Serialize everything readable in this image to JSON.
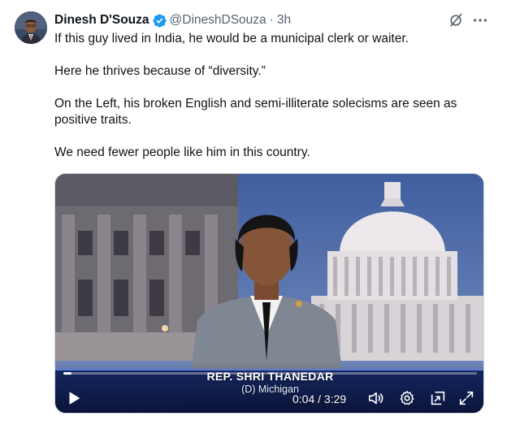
{
  "tweet": {
    "author": {
      "display_name": "Dinesh D'Souza",
      "handle": "@DineshDSouza",
      "verified": true
    },
    "separator": "·",
    "time": "3h",
    "paragraphs": [
      "If this guy lived in India, he would be a municipal clerk or waiter.",
      "Here he thrives because of “diversity.”",
      "On the Left, his broken English and semi-illiterate solecisms are seen as positive traits.",
      "We need fewer people like him in this country."
    ]
  },
  "video": {
    "chyron_name": "REP. SHRI THANEDAR",
    "chyron_sub": "(D) Michigan",
    "time_readout": "0:04 / 3:29",
    "progress_fraction": 0.02
  },
  "colors": {
    "text": "#0f1419",
    "muted": "#536471",
    "verified_blue": "#1d9bf0",
    "border": "#cfd9de"
  },
  "icons": {
    "verified": "verified-badge-icon",
    "grok": "grok-icon",
    "more": "more-horizontal-icon",
    "play": "play-icon",
    "volume": "volume-icon",
    "settings": "settings-gear-icon",
    "pip": "picture-in-picture-icon",
    "fullscreen": "fullscreen-icon"
  }
}
